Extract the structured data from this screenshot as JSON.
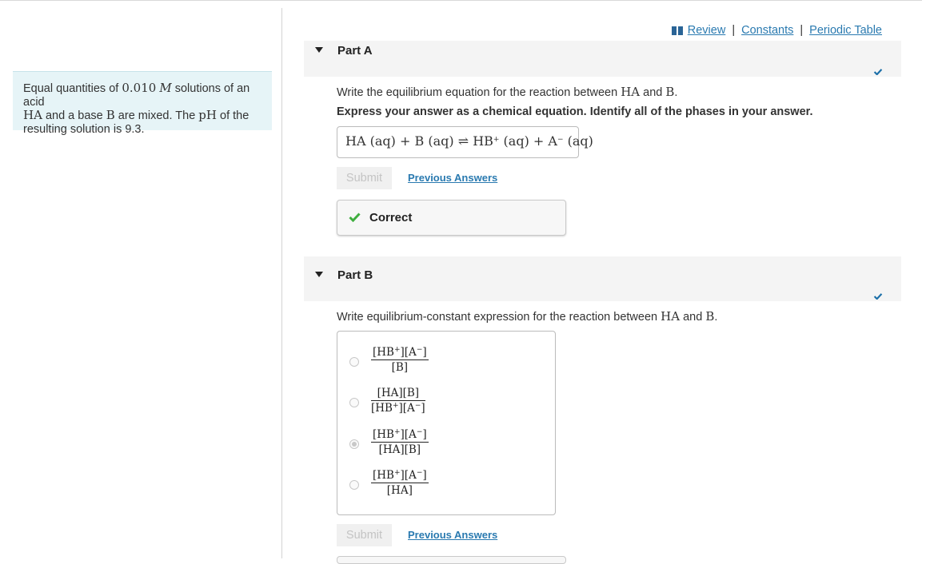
{
  "problem": {
    "intro_pre": "Equal quantities of ",
    "conc_value": "0.010",
    "conc_unit": "M",
    "intro_mid1": " solutions of an acid",
    "acid": "HA",
    "intro_mid2": " and a base ",
    "base": "B",
    "intro_mid3": " are mixed. The ",
    "ph_symbol": "pH",
    "intro_mid4": " of the",
    "intro_end": "resulting solution is 9.3."
  },
  "toplinks": {
    "review": "Review",
    "sep": "|",
    "constants": "Constants",
    "periodic_table": "Periodic Table"
  },
  "partA": {
    "title": "Part A",
    "question_pre": "Write the equilibrium equation for the reaction between ",
    "question_acid": "HA",
    "question_and": " and ",
    "question_base": "B",
    "question_end": ".",
    "instruction": "Express your answer as a chemical equation. Identify all of the phases in your answer.",
    "answer": {
      "ha": "HA",
      "phase1": "(aq)",
      "plus1": "+",
      "b": "B",
      "phase2": "(aq)",
      "arrow": "⇌",
      "hb": "HB",
      "hb_charge": "+",
      "phase3": "(aq)",
      "plus2": "+",
      "a": "A",
      "a_charge": "−",
      "phase4": "(aq)"
    },
    "submit_label": "Submit",
    "previous_answers_label": "Previous Answers",
    "feedback": "Correct"
  },
  "partB": {
    "title": "Part B",
    "question_pre": "Write equilibrium-constant expression for the reaction between ",
    "question_acid": "HA",
    "question_and": " and ",
    "question_base": "B",
    "question_end": ".",
    "options": [
      {
        "num": "[HB+][A−]",
        "den": "[B]",
        "selected": false
      },
      {
        "num": "[HA][B]",
        "den": "[HB+][A−]",
        "selected": false
      },
      {
        "num": "[HB+][A−]",
        "den": "[HA][B]",
        "selected": true
      },
      {
        "num": "[HB+][A−]",
        "den": "[HA]",
        "selected": false
      }
    ],
    "submit_label": "Submit",
    "previous_answers_label": "Previous Answers"
  },
  "colors": {
    "link": "#2a7ab0",
    "check": "#1b6fa8",
    "correct_check": "#3fae3f",
    "intro_bg": "#e6f4f7"
  }
}
